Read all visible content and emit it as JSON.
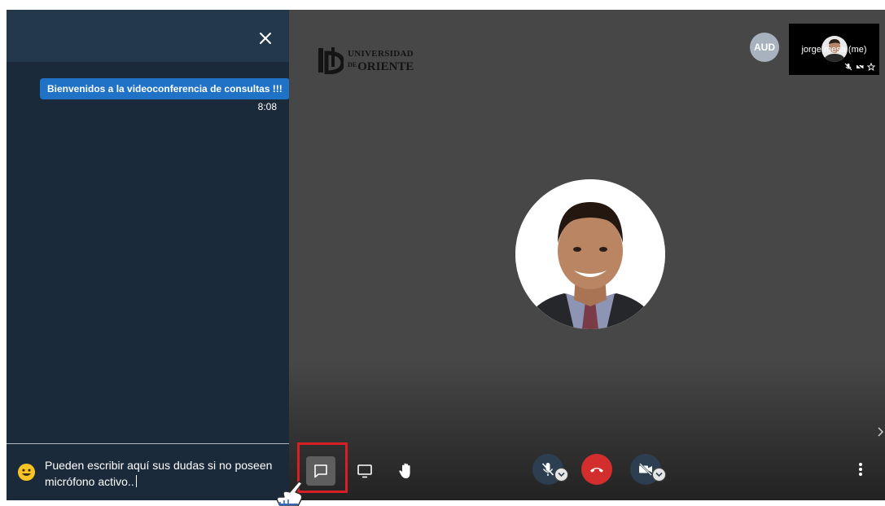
{
  "chat": {
    "close_label": "close",
    "messages": [
      {
        "text": "Bienvenidos a la videoconferencia de consultas !!!",
        "time": "8:08"
      }
    ],
    "input_value": "Pueden escribir aquí sus dudas si no poseen micrófono activo.."
  },
  "logo": {
    "line1": "UNIVERSIDAD",
    "line2_prefix": "DE",
    "line2": "ORIENTE"
  },
  "participants": {
    "aud_badge": "AUD",
    "self_name": "jorge.mesa (me)"
  },
  "colors": {
    "accent_blue": "#1f72c6",
    "hangup_red": "#d32e2e",
    "highlight_red": "#d71f26",
    "chat_bg": "#1b2a3a",
    "stage_bg": "#474747"
  },
  "icons": {
    "chat_toggle": "chat-icon",
    "screen_share": "screen-share-icon",
    "raise_hand": "raise-hand-icon",
    "mic": "mic-muted-icon",
    "hangup": "hangup-icon",
    "camera": "camera-off-icon",
    "more": "more-vertical-icon"
  }
}
